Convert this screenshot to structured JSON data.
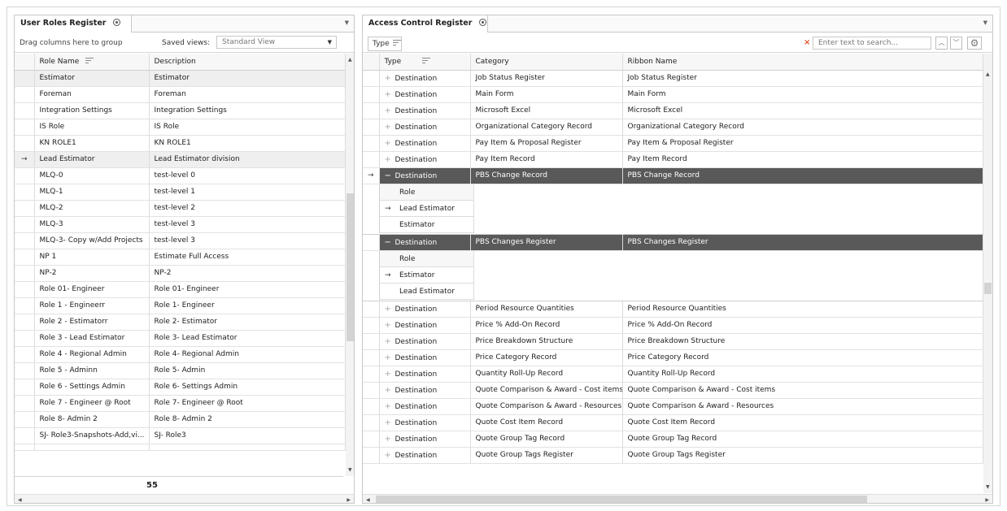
{
  "left": {
    "tab_title": "User Roles Register",
    "group_hint": "Drag columns here to group",
    "saved_views_label": "Saved views:",
    "saved_view_value": "Standard View",
    "columns": [
      "Role Name",
      "Description"
    ],
    "rows": [
      {
        "name": "Estimator",
        "desc": "Estimator",
        "highlight": true
      },
      {
        "name": "Foreman",
        "desc": "Foreman"
      },
      {
        "name": "Integration Settings",
        "desc": "Integration Settings"
      },
      {
        "name": "IS Role",
        "desc": "IS Role"
      },
      {
        "name": "KN ROLE1",
        "desc": "KN ROLE1"
      },
      {
        "name": "Lead Estimator",
        "desc": "Lead Estimator division",
        "highlight": true,
        "current": true
      },
      {
        "name": "MLQ-0",
        "desc": "test-level 0"
      },
      {
        "name": "MLQ-1",
        "desc": "test-level 1"
      },
      {
        "name": "MLQ-2",
        "desc": "test-level 2"
      },
      {
        "name": "MLQ-3",
        "desc": "test-level 3"
      },
      {
        "name": "MLQ-3- Copy w/Add Projects",
        "desc": "test-level 3"
      },
      {
        "name": "NP 1",
        "desc": "Estimate Full Access"
      },
      {
        "name": "NP-2",
        "desc": "NP-2"
      },
      {
        "name": "Role 01- Engineer",
        "desc": "Role 01- Engineer"
      },
      {
        "name": "Role 1 - Engineerr",
        "desc": "Role 1- Engineer"
      },
      {
        "name": "Role 2 - Estimatorr",
        "desc": "Role 2- Estimator"
      },
      {
        "name": "Role 3 - Lead Estimator",
        "desc": "Role 3- Lead Estimator"
      },
      {
        "name": "Role 4 - Regional Admin",
        "desc": "Role 4- Regional Admin"
      },
      {
        "name": "Role 5 - Adminn",
        "desc": "Role 5- Admin"
      },
      {
        "name": "Role 6 - Settings Admin",
        "desc": "Role 6- Settings Admin"
      },
      {
        "name": "Role 7 - Engineer @ Root",
        "desc": "Role 7- Engineer @ Root"
      },
      {
        "name": "Role 8- Admin 2",
        "desc": "Role 8- Admin 2"
      },
      {
        "name": "SJ- Role3-Snapshots-Add,vi...",
        "desc": "SJ- Role3"
      }
    ],
    "count": "55"
  },
  "right": {
    "tab_title": "Access Control Register",
    "type_chip": "Type",
    "search_placeholder": "Enter text to search...",
    "columns": [
      "Type",
      "Category",
      "Ribbon Name"
    ],
    "rows": [
      {
        "type": "Destination",
        "category": "Job Status Register",
        "ribbon": "Job Status Register"
      },
      {
        "type": "Destination",
        "category": "Main Form",
        "ribbon": "Main Form"
      },
      {
        "type": "Destination",
        "category": "Microsoft Excel",
        "ribbon": "Microsoft Excel"
      },
      {
        "type": "Destination",
        "category": "Organizational Category Record",
        "ribbon": "Organizational Category Record"
      },
      {
        "type": "Destination",
        "category": "Pay Item & Proposal Register",
        "ribbon": "Pay Item & Proposal Register"
      },
      {
        "type": "Destination",
        "category": "Pay Item Record",
        "ribbon": "Pay Item Record"
      },
      {
        "type": "Destination",
        "category": "PBS Change Record",
        "ribbon": "PBS Change Record",
        "expanded": true,
        "current": true,
        "detail": {
          "header": "Role",
          "rows": [
            "Lead Estimator",
            "Estimator"
          ],
          "current_index": 0
        }
      },
      {
        "type": "Destination",
        "category": "PBS Changes Register",
        "ribbon": "PBS Changes Register",
        "expanded": true,
        "detail": {
          "header": "Role",
          "rows": [
            "Estimator",
            "Lead Estimator"
          ],
          "current_index": 0
        }
      },
      {
        "type": "Destination",
        "category": "Period Resource Quantities",
        "ribbon": "Period Resource Quantities"
      },
      {
        "type": "Destination",
        "category": "Price % Add-On Record",
        "ribbon": "Price % Add-On Record"
      },
      {
        "type": "Destination",
        "category": "Price Breakdown Structure",
        "ribbon": "Price Breakdown Structure"
      },
      {
        "type": "Destination",
        "category": "Price Category Record",
        "ribbon": "Price Category Record"
      },
      {
        "type": "Destination",
        "category": "Quantity Roll-Up Record",
        "ribbon": "Quantity Roll-Up Record"
      },
      {
        "type": "Destination",
        "category": "Quote Comparison & Award - Cost items",
        "ribbon": "Quote Comparison & Award - Cost items"
      },
      {
        "type": "Destination",
        "category": "Quote Comparison & Award - Resources",
        "ribbon": "Quote Comparison & Award - Resources"
      },
      {
        "type": "Destination",
        "category": "Quote Cost Item Record",
        "ribbon": "Quote Cost Item Record"
      },
      {
        "type": "Destination",
        "category": "Quote Group Tag Record",
        "ribbon": "Quote Group Tag Record"
      },
      {
        "type": "Destination",
        "category": "Quote Group Tags Register",
        "ribbon": "Quote Group Tags Register"
      }
    ]
  },
  "icons": {
    "row_indicator": "→",
    "expand": "+",
    "collapse": "−"
  }
}
